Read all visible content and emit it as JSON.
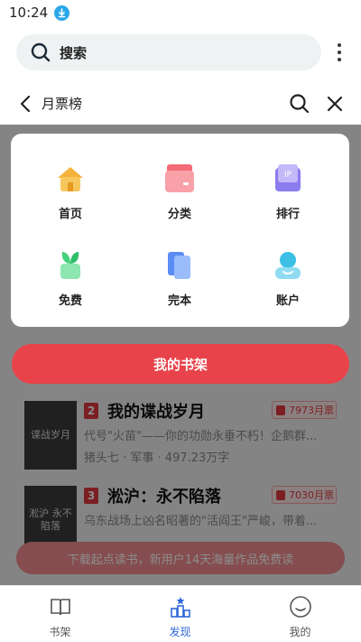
{
  "status": {
    "time": "10:24"
  },
  "search": {
    "label": "搜索"
  },
  "nav": {
    "title": "月票榜"
  },
  "menu": {
    "items": [
      {
        "label": "首页",
        "icon": "home-icon",
        "color": "#f5b23a"
      },
      {
        "label": "分类",
        "icon": "category-icon",
        "color": "#f47a84"
      },
      {
        "label": "排行",
        "icon": "ranking-icon",
        "color": "#8b7cf0"
      },
      {
        "label": "免费",
        "icon": "free-icon",
        "color": "#45d17d"
      },
      {
        "label": "完本",
        "icon": "finished-icon",
        "color": "#5b8df5"
      },
      {
        "label": "账户",
        "icon": "account-icon",
        "color": "#3cc0e6"
      }
    ]
  },
  "shelf_button": {
    "label": "我的书架"
  },
  "books": [
    {
      "rank": "2",
      "title": "我的谍战岁月",
      "tickets": "7973月票",
      "cover_text": "谍战岁月",
      "description": "代号\"火苗\"——你的功勋永垂不朽！企鹅群...",
      "meta": "猪头七 · 军事 · 497.23万字"
    },
    {
      "rank": "3",
      "title": "淞沪：永不陷落",
      "tickets": "7030月票",
      "cover_text": "淞沪 永不陷落",
      "description": "乌东战场上凶名昭著的\"活阎王\"严峻，带着...",
      "meta": ""
    }
  ],
  "download_banner": "下载起点读书，新用户14天海量作品免费读",
  "tabs": [
    {
      "label": "书架",
      "icon": "bookshelf-icon",
      "active": false
    },
    {
      "label": "发现",
      "icon": "discover-icon",
      "active": true
    },
    {
      "label": "我的",
      "icon": "profile-icon",
      "active": false
    }
  ],
  "colors": {
    "accent": "#e8434a",
    "active_tab": "#2f66d6"
  }
}
